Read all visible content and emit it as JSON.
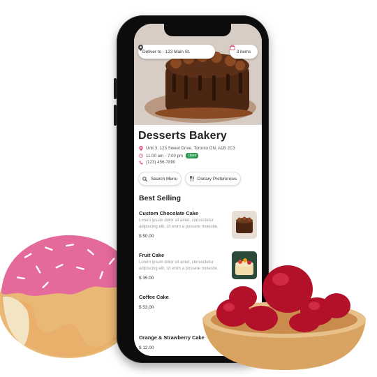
{
  "header": {
    "address_label": "Deliver to - 123 Main St.",
    "cart_label": "3 items"
  },
  "store": {
    "name": "Desserts Bakery",
    "address": "Unit 3, 123 Sweet Drive, Toronto ON, A1B 2C3",
    "hours": "11:00 am - 7:00 pm",
    "status": "Open",
    "phone": "(123) 456-7890",
    "status_color": "#2e9b55",
    "accent_color": "#e0507a"
  },
  "actions": {
    "search_label": "Search Menu",
    "dietary_label": "Dietary Preferences"
  },
  "menu": {
    "section_title": "Best Selling",
    "items": [
      {
        "name": "Custom Chocolate Cake",
        "description": "Lorem ipsum dolor sit amet, consectetur adipiscing elit. Ut enim a possere molestie.",
        "price": "$ 50.00"
      },
      {
        "name": "Fruit Cake",
        "description": "Lorem ipsum dolor sit amet, consectetur adipiscing elit. Ut enim a possere molestie.",
        "price": "$ 35.00"
      },
      {
        "name": "Coffee Cake",
        "description": "",
        "price": "$ 53.00"
      },
      {
        "name": "Orange & Strawberry Cake",
        "description": "",
        "price": "$ 12.00"
      }
    ]
  }
}
